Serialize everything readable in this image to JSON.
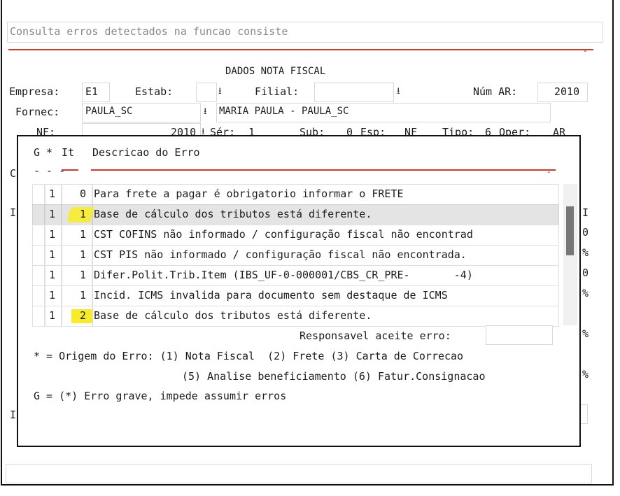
{
  "search": {
    "label": "Consulta erros detectados na funcao consiste"
  },
  "form": {
    "section_title": "DADOS NOTA FISCAL",
    "empresa_label": "Empresa:",
    "empresa_value": "E1",
    "estab_label": "Estab:",
    "estab_value": "",
    "filial_label": "Filial:",
    "filial_value": "",
    "num_ar_label": "Núm AR:",
    "num_ar_value": "2010",
    "fornec_label": "Fornec:",
    "fornec_value": "PAULA_SC",
    "fornec_name": "MARIA PAULA - PAULA_SC",
    "nf_label": "NF:",
    "nf_value": "2010",
    "serie_label": "Sér:",
    "serie_value": "1",
    "sub_label": "Sub:",
    "sub_value": "0",
    "esp_label": "Esp:",
    "esp_value": "NF",
    "tipo_label": "Tipo:",
    "tipo_value": "6",
    "oper_label": "Oper:",
    "oper_value": "AR",
    "left_c": "C",
    "left_i1": "I",
    "left_i2": "I",
    "right_i": "I",
    "right_0a": "0",
    "right_pct1": "%",
    "right_0b": "0",
    "right_pct2": "%",
    "right_pct3": "%",
    "right_pct4": "%"
  },
  "dialog": {
    "header_g": "G",
    "header_star": "*",
    "header_it": "It",
    "header_desc": "Descricao do Erro",
    "header_dashes": "- - -",
    "rows": [
      {
        "g": "",
        "star": "1",
        "it": "0",
        "desc": "Para frete a pagar é obrigatorio informar o FRETE"
      },
      {
        "g": "",
        "star": "1",
        "it": "1",
        "desc": "Base de cálculo dos tributos está diferente."
      },
      {
        "g": "",
        "star": "1",
        "it": "1",
        "desc": "CST COFINS não informado / configuração fiscal não encontrad"
      },
      {
        "g": "",
        "star": "1",
        "it": "1",
        "desc": "CST PIS não informado / configuração fiscal não encontrada."
      },
      {
        "g": "",
        "star": "1",
        "it": "1",
        "desc": "Difer.Polit.Trib.Item (IBS_UF-0-000001/CBS_CR_PRE-       -4)"
      },
      {
        "g": "",
        "star": "1",
        "it": "1",
        "desc": "Incid. ICMS invalida para documento sem destaque de ICMS"
      },
      {
        "g": "",
        "star": "1",
        "it": "2",
        "desc": "Base de cálculo dos tributos está diferente."
      }
    ],
    "responsavel_label": "Responsavel aceite erro:",
    "responsavel_value": "",
    "legend_line1": "* = Origem do Erro: (1) Nota Fiscal  (2) Frete (3) Carta de Correcao",
    "legend_line2": "(5) Analise beneficiamento (6) Fatur.Consignacao",
    "legend_line3": "G = (*) Erro grave, impede assumir erros"
  },
  "colors": {
    "accent_red": "#d23a2a",
    "highlight": "#f6ec2a",
    "selected_row": "#e4e4e4"
  },
  "icons": {
    "dropdown": "download-arrow-icon"
  }
}
